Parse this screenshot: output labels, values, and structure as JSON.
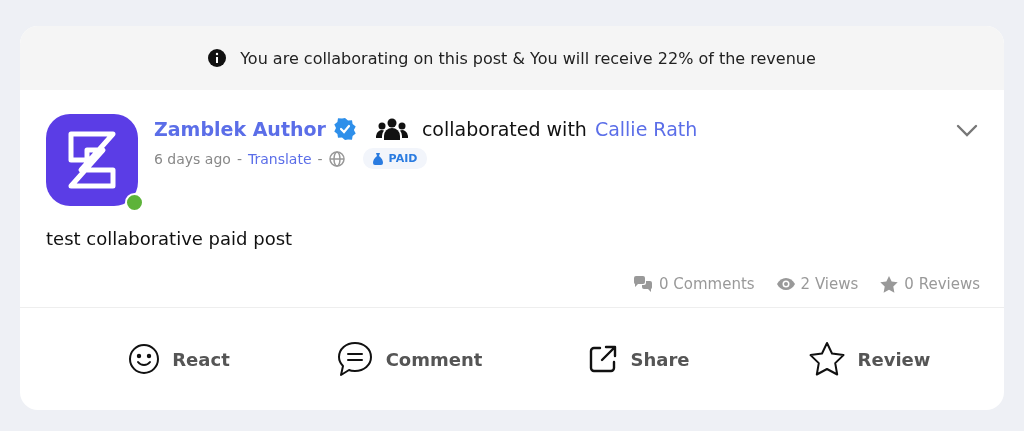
{
  "banner": {
    "text": "You are collaborating on this post & You will receive 22% of the revenue"
  },
  "post": {
    "author": "Zamblek Author",
    "verified": true,
    "online": true,
    "collab_text": "collaborated with",
    "collaborator": "Callie Rath",
    "time": "6 days ago",
    "separator_1": "-",
    "translate": "Translate",
    "separator_2": "-",
    "badge": "PAID",
    "body": "test collaborative paid post"
  },
  "stats": [
    {
      "kind": "comments",
      "label": "0 Comments"
    },
    {
      "kind": "views",
      "label": "2 Views"
    },
    {
      "kind": "reviews",
      "label": "0 Reviews"
    }
  ],
  "actions": [
    {
      "kind": "react",
      "label": "React"
    },
    {
      "kind": "comment",
      "label": "Comment"
    },
    {
      "kind": "share",
      "label": "Share"
    },
    {
      "kind": "review",
      "label": "Review"
    }
  ]
}
